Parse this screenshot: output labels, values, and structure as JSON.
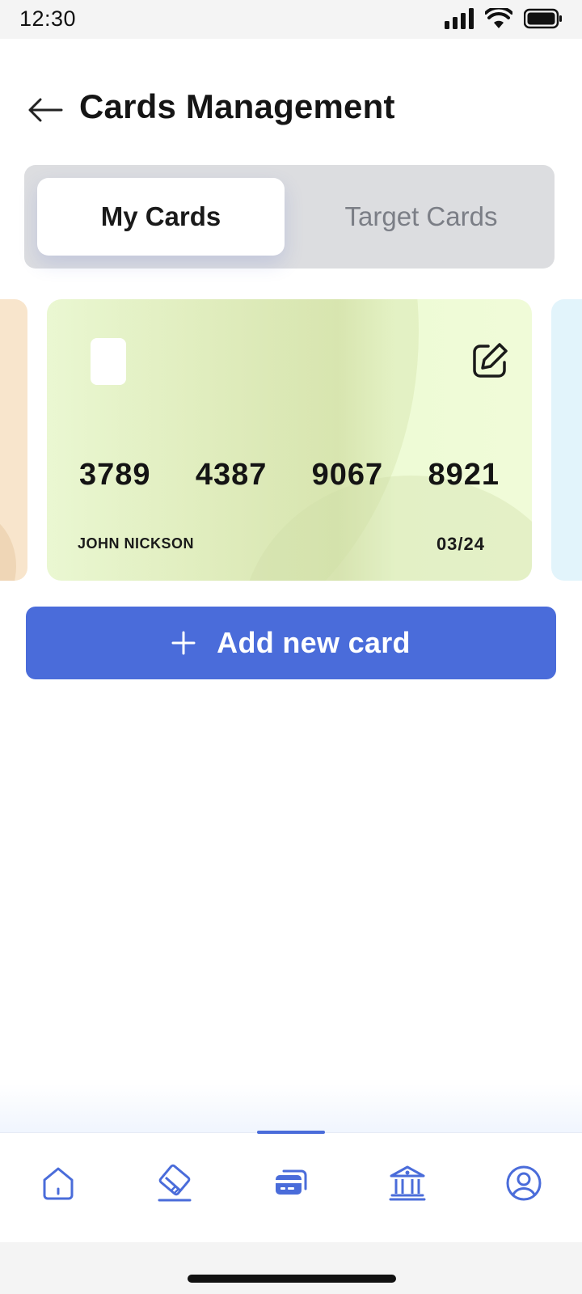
{
  "status_bar": {
    "time": "12:30"
  },
  "header": {
    "title": "Cards Management"
  },
  "tabs": [
    {
      "label": "My Cards",
      "selected": true
    },
    {
      "label": "Target Cards",
      "selected": false
    }
  ],
  "card": {
    "number_groups": [
      "3789",
      "4387",
      "9067",
      "8921"
    ],
    "holder": "JOHN NICKSON",
    "expiry": "03/24",
    "color": "#eefbd9"
  },
  "add_button": {
    "label": "Add new card",
    "color": "#4a6cda"
  },
  "bottom_nav": {
    "active_index": 2,
    "items": [
      {
        "icon": "home-icon"
      },
      {
        "icon": "card-payment-icon"
      },
      {
        "icon": "cards-icon"
      },
      {
        "icon": "bank-icon"
      },
      {
        "icon": "profile-icon"
      }
    ]
  },
  "colors": {
    "accent": "#4a6cda",
    "icon": "#4a6cda"
  }
}
